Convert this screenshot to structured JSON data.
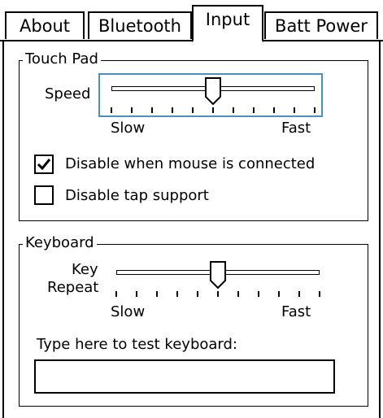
{
  "tabs": [
    {
      "label": "About",
      "active": false
    },
    {
      "label": "Bluetooth",
      "active": false
    },
    {
      "label": "Input",
      "active": true
    },
    {
      "label": "Batt Power",
      "active": false
    }
  ],
  "touchpad": {
    "title": "Touch Pad",
    "speed_label": "Speed",
    "slider_min_label": "Slow",
    "slider_max_label": "Fast",
    "speed_level": 0.5,
    "disable_when_mouse_label": "Disable when mouse is connected",
    "disable_when_mouse_checked": true,
    "disable_tap_label": "Disable tap support",
    "disable_tap_checked": false
  },
  "keyboard": {
    "title": "Keyboard",
    "key_repeat_label_line1": "Key",
    "key_repeat_label_line2": "Repeat",
    "slider_min_label": "Slow",
    "slider_max_label": "Fast",
    "repeat_level": 0.5,
    "test_prompt": "Type here to test keyboard:",
    "test_value": ""
  },
  "colors": {
    "focus_border": "#4a90c8"
  }
}
